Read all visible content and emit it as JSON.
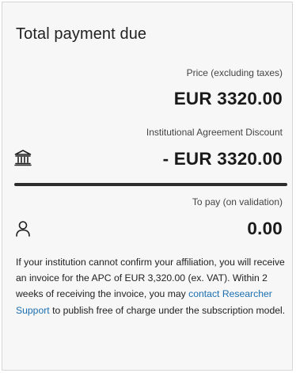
{
  "card": {
    "title": "Total payment due"
  },
  "price": {
    "label": "Price (excluding taxes)",
    "value": "EUR 3320.00"
  },
  "discount": {
    "label": "Institutional Agreement Discount",
    "value": "- EUR 3320.00",
    "icon": "institution-icon"
  },
  "to_pay": {
    "label": "To pay (on validation)",
    "value": "0.00",
    "icon": "user-icon"
  },
  "note": {
    "text_before": "If your institution cannot confirm your affiliation, you will receive an invoice for the APC of EUR 3,320.00 (ex. VAT). Within 2 weeks of receiving the invoice, you may ",
    "link_text": "contact Researcher Support",
    "text_after": " to publish free of charge under the subscription model."
  },
  "colors": {
    "link": "#1b6fb0",
    "divider": "#2e2e2e",
    "card_background": "#f7f7f7"
  }
}
